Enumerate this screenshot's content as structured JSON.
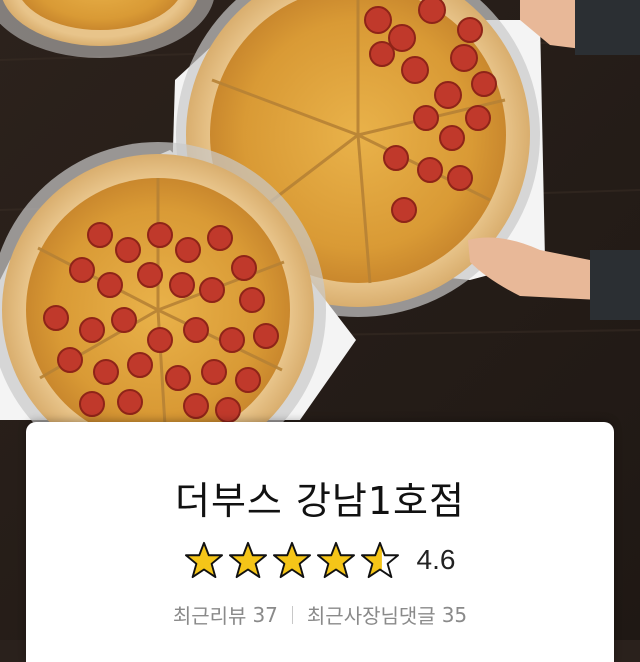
{
  "store": {
    "name": "더부스 강남1호점",
    "rating": 4.6,
    "rating_text": "4.6",
    "star_count": 5,
    "star_color": "#f5c518"
  },
  "stats": {
    "recent_reviews_label": "최근리뷰",
    "recent_reviews_count": "37",
    "owner_comments_label": "최근사장님댓글",
    "owner_comments_count": "35"
  },
  "hero": {
    "icon": "pizza-photo"
  }
}
